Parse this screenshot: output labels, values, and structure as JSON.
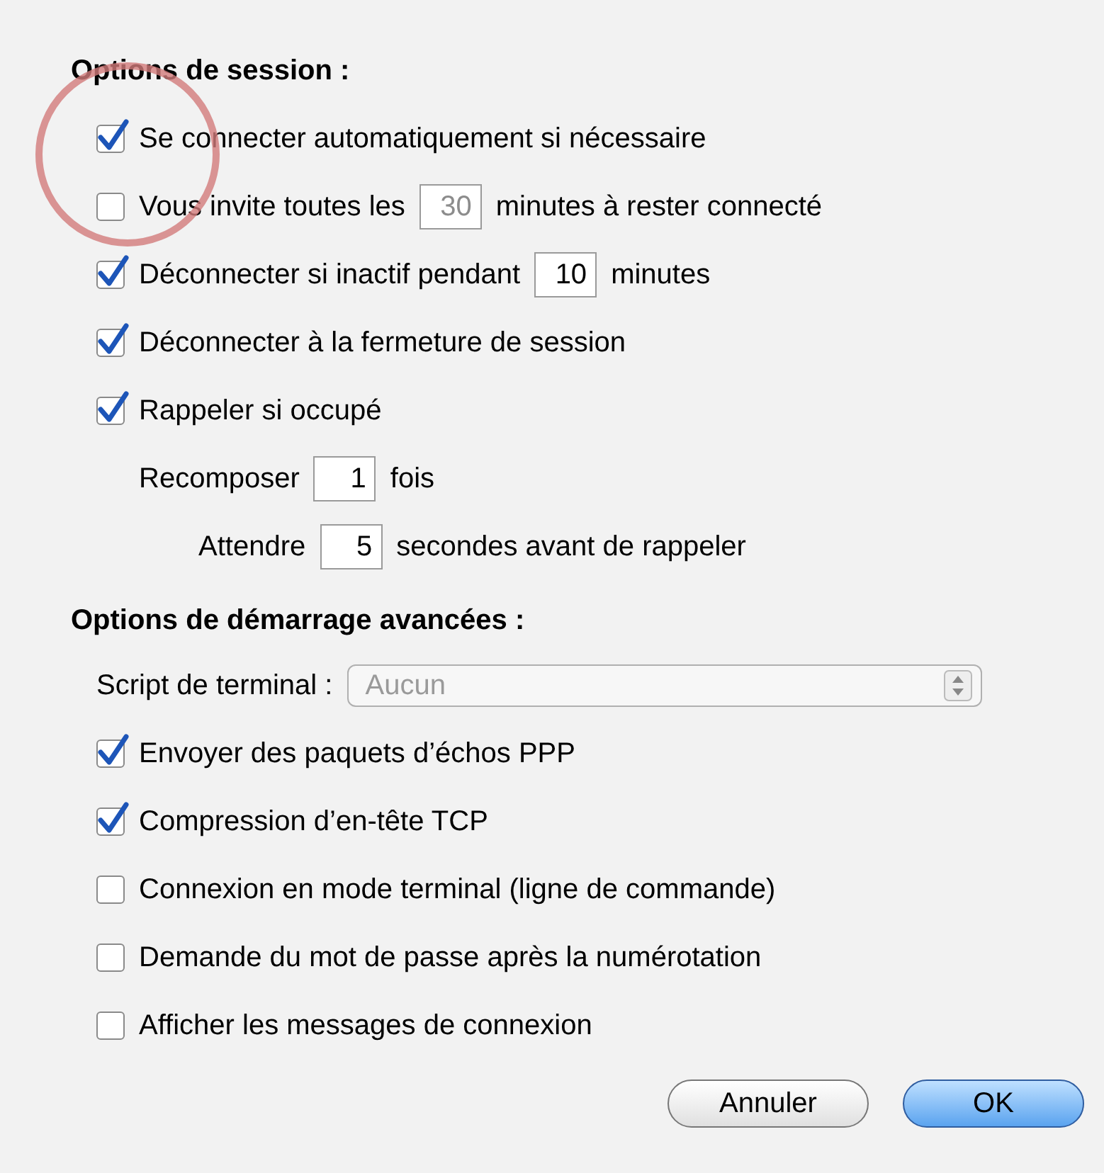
{
  "session": {
    "title": "Options de session :",
    "items": [
      {
        "kind": "checkbox",
        "label": "Se connecter automatiquement si nécessaire",
        "checked": true
      },
      {
        "kind": "checkbox_field",
        "checked": false,
        "before": "Vous invite toutes les",
        "value": "30",
        "field_disabled": true,
        "after": "minutes à rester connecté"
      },
      {
        "kind": "checkbox_field",
        "checked": true,
        "before": "Déconnecter si inactif pendant",
        "value": "10",
        "field_disabled": false,
        "after": "minutes"
      },
      {
        "kind": "checkbox",
        "label": "Déconnecter à la fermeture de session",
        "checked": true
      },
      {
        "kind": "checkbox",
        "label": "Rappeler si occupé",
        "checked": true,
        "children": [
          {
            "kind": "field",
            "before": "Recomposer",
            "value": "1",
            "after": "fois",
            "children": [
              {
                "kind": "field",
                "before": "Attendre",
                "value": "5",
                "after": "secondes avant de rappeler"
              }
            ]
          }
        ]
      }
    ]
  },
  "advanced": {
    "title": "Options de démarrage avancées :",
    "script": {
      "label": "Script de terminal :",
      "value": "Aucun",
      "disabled": true
    },
    "items": [
      {
        "kind": "checkbox",
        "label": "Envoyer des paquets d’échos PPP",
        "checked": true
      },
      {
        "kind": "checkbox",
        "label": "Compression d’en-tête TCP",
        "checked": true
      },
      {
        "kind": "checkbox",
        "label": "Connexion en mode terminal (ligne de commande)",
        "checked": false
      },
      {
        "kind": "checkbox",
        "label": "Demande du mot de passe après la numérotation",
        "checked": false
      },
      {
        "kind": "checkbox",
        "label": "Afficher les messages de connexion",
        "checked": false
      }
    ]
  },
  "buttons": [
    {
      "label": "Annuler",
      "default": false
    },
    {
      "label": "OK",
      "default": true
    }
  ],
  "annotation": {
    "kind": "circle"
  }
}
